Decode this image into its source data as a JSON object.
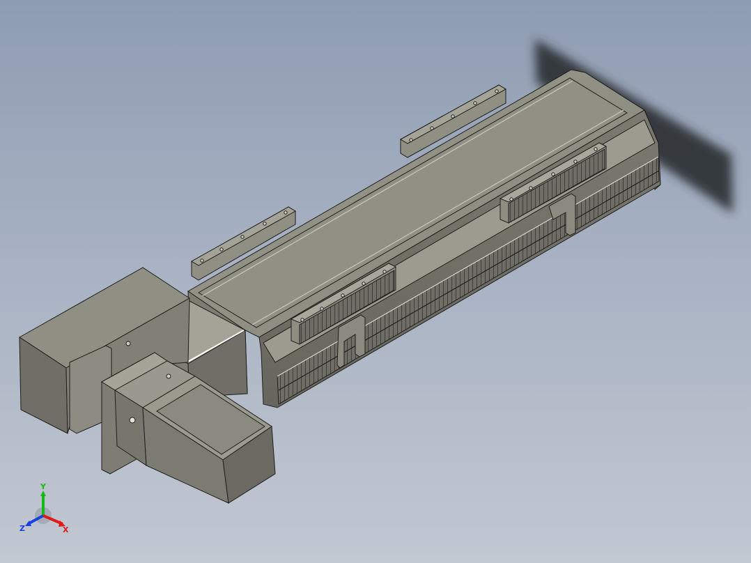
{
  "viewport": {
    "background_top": "#8e9cb2",
    "background_bottom": "#c2c8d2"
  },
  "model": {
    "body_color": "#8c8c80",
    "body_light": "#b3b3a8",
    "body_dark": "#5f5f57",
    "edge_color": "#1e1e1c"
  },
  "triad": {
    "x_label": "X",
    "y_label": "Y",
    "z_label": "Z",
    "x_color": "#e01818",
    "y_color": "#18b818",
    "z_color": "#1a3fe0"
  }
}
